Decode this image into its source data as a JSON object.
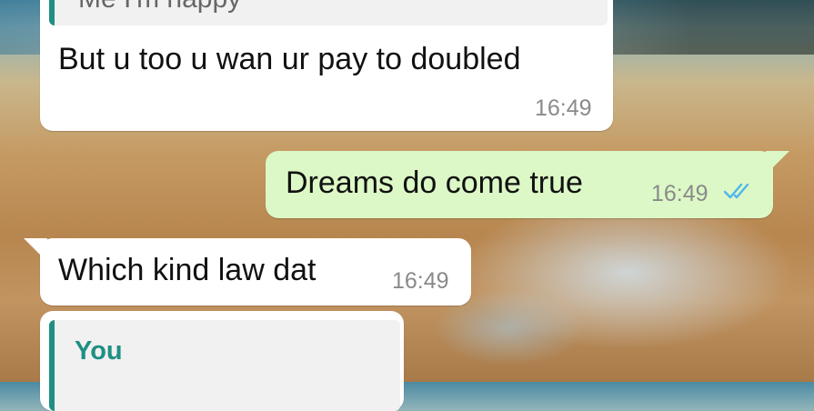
{
  "messages": [
    {
      "direction": "incoming",
      "quoted_text": "Me I'm happy",
      "text": "But u too u wan ur pay to doubled",
      "time": "16:49"
    },
    {
      "direction": "outgoing",
      "text": "Dreams do come true",
      "time": "16:49",
      "status_icon": "double-check-read-icon"
    },
    {
      "direction": "incoming",
      "text": "Which kind law dat",
      "time": "16:49"
    },
    {
      "direction": "incoming",
      "quoted_author": "You"
    }
  ],
  "colors": {
    "incoming_bubble": "#ffffff",
    "outgoing_bubble": "#dcf8c6",
    "quote_accent": "#1f8f84",
    "read_ticks": "#4fb6ec"
  }
}
